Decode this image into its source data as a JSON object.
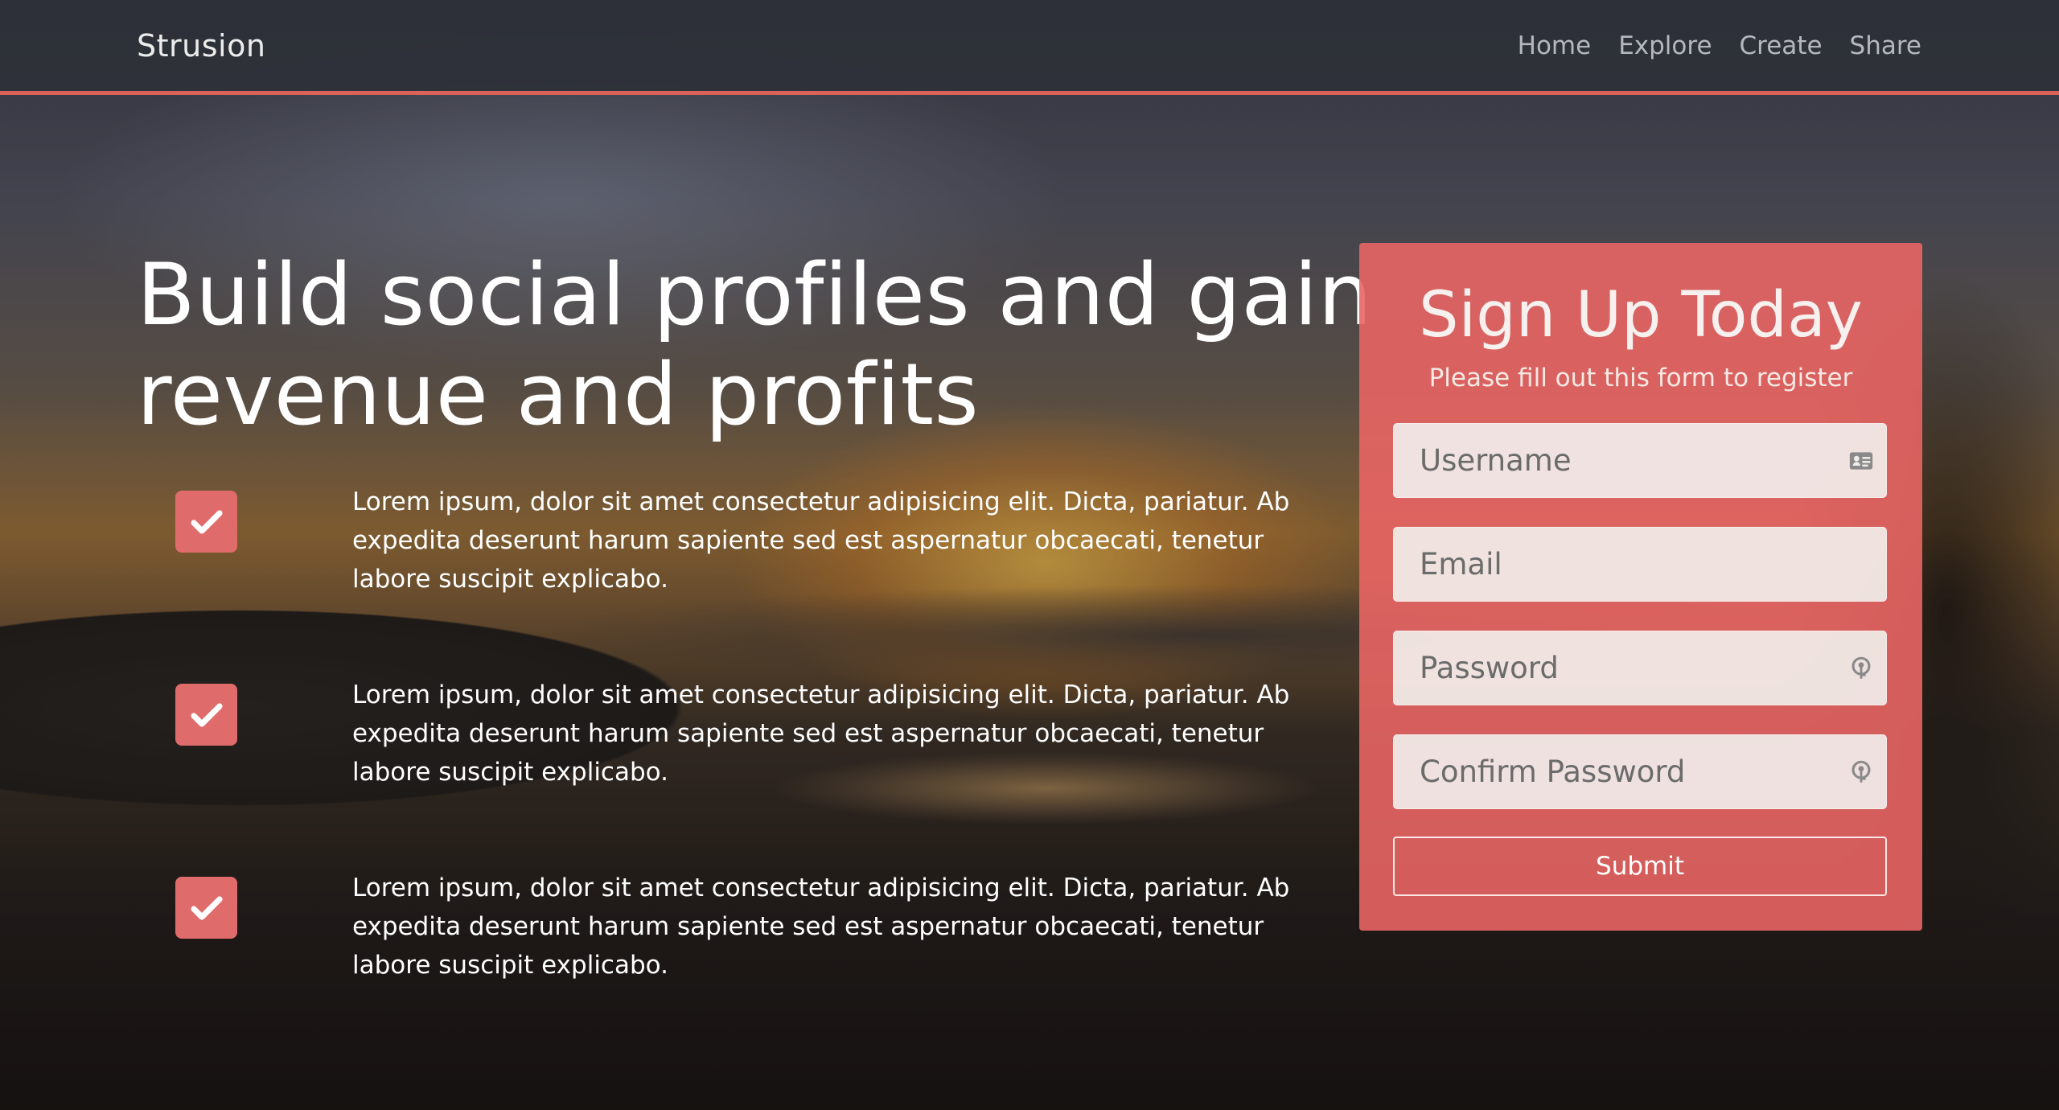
{
  "navbar": {
    "brand": "Strusion",
    "links": [
      {
        "label": "Home"
      },
      {
        "label": "Explore"
      },
      {
        "label": "Create"
      },
      {
        "label": "Share"
      }
    ]
  },
  "hero": {
    "title": "Build social profiles and gain revenue and profits",
    "features": [
      {
        "icon": "check-icon",
        "text": "Lorem ipsum, dolor sit amet consectetur adipisicing elit. Dicta, pariatur. Ab expedita deserunt harum sapiente sed est aspernatur obcaecati, tenetur labore suscipit explicabo."
      },
      {
        "icon": "check-icon",
        "text": "Lorem ipsum, dolor sit amet consectetur adipisicing elit. Dicta, pariatur. Ab expedita deserunt harum sapiente sed est aspernatur obcaecati, tenetur labore suscipit explicabo."
      },
      {
        "icon": "check-icon",
        "text": "Lorem ipsum, dolor sit amet consectetur adipisicing elit. Dicta, pariatur. Ab expedita deserunt harum sapiente sed est aspernatur obcaecati, tenetur labore suscipit explicabo."
      }
    ]
  },
  "signup": {
    "title": "Sign Up Today",
    "subtitle": "Please fill out this form to register",
    "fields": {
      "username": {
        "placeholder": "Username",
        "value": "",
        "icon": "id-card-icon"
      },
      "email": {
        "placeholder": "Email",
        "value": ""
      },
      "password": {
        "placeholder": "Password",
        "value": "",
        "icon": "key-icon"
      },
      "confirm_password": {
        "placeholder": "Confirm Password",
        "value": "",
        "icon": "key-icon"
      }
    },
    "submit_label": "Submit"
  },
  "colors": {
    "accent": "#d9625b",
    "card": "#e86564",
    "navbar": "#2d3038"
  }
}
